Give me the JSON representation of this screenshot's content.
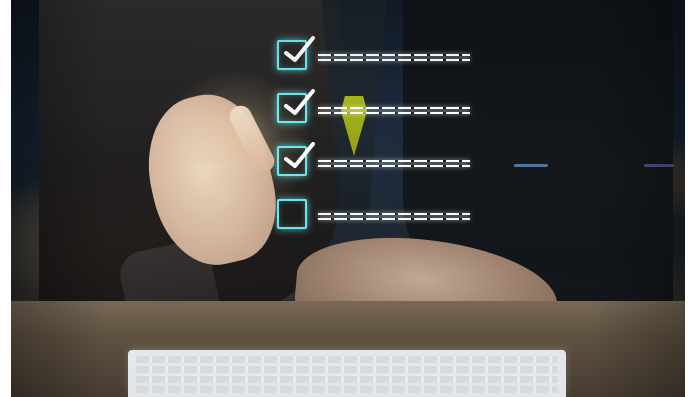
{
  "image": {
    "subject": "",
    "accent_color": "#6fe9ef",
    "checklist": {
      "items": [
        {
          "checked": true,
          "icon": "check-icon"
        },
        {
          "checked": true,
          "icon": "check-icon"
        },
        {
          "checked": true,
          "icon": "check-icon"
        },
        {
          "checked": false,
          "icon": ""
        }
      ]
    }
  }
}
